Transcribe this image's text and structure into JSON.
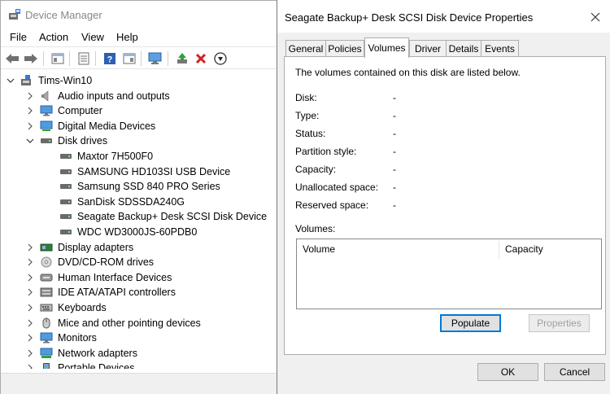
{
  "device_manager": {
    "title": "Device Manager",
    "menu": [
      "File",
      "Action",
      "View",
      "Help"
    ],
    "tree": {
      "root": "Tims-Win10",
      "nodes": [
        {
          "label": "Audio inputs and outputs",
          "icon": "speaker-icon",
          "expanded": false
        },
        {
          "label": "Computer",
          "icon": "monitor-icon",
          "expanded": false
        },
        {
          "label": "Digital Media Devices",
          "icon": "media-device-icon",
          "expanded": false
        },
        {
          "label": "Disk drives",
          "icon": "disk-drive-icon",
          "expanded": true,
          "children": [
            "Maxtor 7H500F0",
            "SAMSUNG HD103SI USB Device",
            "Samsung SSD 840 PRO Series",
            "SanDisk SDSSDA240G",
            "Seagate Backup+  Desk SCSI Disk Device",
            "WDC WD3000JS-60PDB0"
          ]
        },
        {
          "label": "Display adapters",
          "icon": "display-adapter-icon",
          "expanded": false
        },
        {
          "label": "DVD/CD-ROM drives",
          "icon": "dvd-icon",
          "expanded": false
        },
        {
          "label": "Human Interface Devices",
          "icon": "hid-icon",
          "expanded": false
        },
        {
          "label": "IDE ATA/ATAPI controllers",
          "icon": "ide-controller-icon",
          "expanded": false
        },
        {
          "label": "Keyboards",
          "icon": "keyboard-icon",
          "expanded": false
        },
        {
          "label": "Mice and other pointing devices",
          "icon": "mouse-icon",
          "expanded": false
        },
        {
          "label": "Monitors",
          "icon": "monitor-icon",
          "expanded": false
        },
        {
          "label": "Network adapters",
          "icon": "network-adapter-icon",
          "expanded": false
        },
        {
          "label": "Portable Devices",
          "icon": "portable-device-icon",
          "expanded": false
        }
      ]
    }
  },
  "dialog": {
    "title": "Seagate Backup+  Desk SCSI Disk Device Properties",
    "tabs": [
      "General",
      "Policies",
      "Volumes",
      "Driver",
      "Details",
      "Events"
    ],
    "active_tab": "Volumes",
    "description": "The volumes contained on this disk are listed below.",
    "fields": [
      {
        "label": "Disk:",
        "value": "-"
      },
      {
        "label": "Type:",
        "value": "-"
      },
      {
        "label": "Status:",
        "value": "-"
      },
      {
        "label": "Partition style:",
        "value": "-"
      },
      {
        "label": "Capacity:",
        "value": "-"
      },
      {
        "label": "Unallocated space:",
        "value": "-"
      },
      {
        "label": "Reserved space:",
        "value": "-"
      }
    ],
    "volumes_label": "Volumes:",
    "columns": [
      "Volume",
      "Capacity"
    ],
    "populate_label": "Populate",
    "properties_label": "Properties",
    "ok_label": "OK",
    "cancel_label": "Cancel"
  },
  "colors": {
    "accent": "#0078d7",
    "disabled_text": "#a0a0a0",
    "dialog_bg": "#f0f0f0"
  }
}
